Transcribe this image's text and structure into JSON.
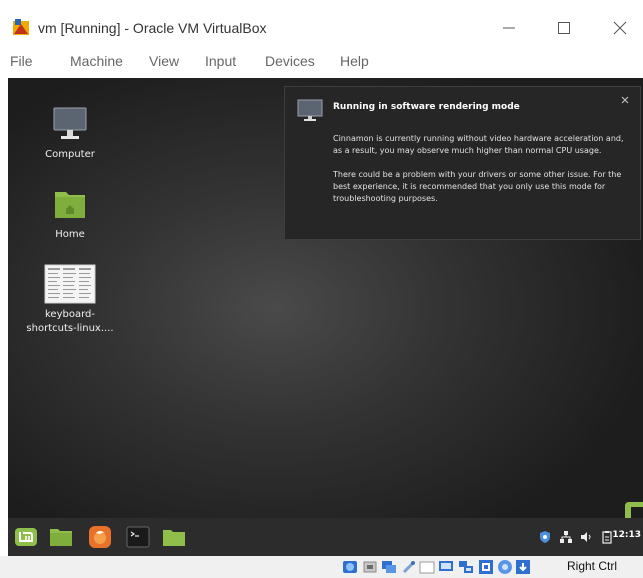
{
  "window": {
    "title": "vm [Running] - Oracle VM VirtualBox",
    "app_icon": "virtualbox-icon"
  },
  "menu": [
    "File",
    "Machine",
    "View",
    "Input",
    "Devices",
    "Help"
  ],
  "desktop": {
    "icons": [
      {
        "label": "Computer",
        "icon": "computer-icon"
      },
      {
        "label": "Home",
        "icon": "home-folder-icon"
      },
      {
        "label": "keyboard-\nshortcuts-linux....",
        "icon": "document-thumbnail-icon"
      }
    ]
  },
  "notification": {
    "title": "Running in software rendering mode",
    "para1": "Cinnamon is currently running without video hardware acceleration and, as a result, you may observe much higher than normal CPU usage.",
    "para2": "There could be a problem with your drivers or some other issue. For the best experience, it is recommended that you only use this mode for troubleshooting purposes."
  },
  "panel": {
    "launchers": [
      "menu-icon",
      "files-icon",
      "firefox-icon",
      "terminal-icon",
      "folder-icon"
    ],
    "tray": [
      "shield-icon",
      "network-icon",
      "volume-icon",
      "clipboard-icon"
    ],
    "clock": "12:13"
  },
  "statusbar": {
    "host_key": "Right Ctrl"
  },
  "colors": {
    "mint_green": "#8fbe4a",
    "firefox_orange": "#e8722a"
  }
}
